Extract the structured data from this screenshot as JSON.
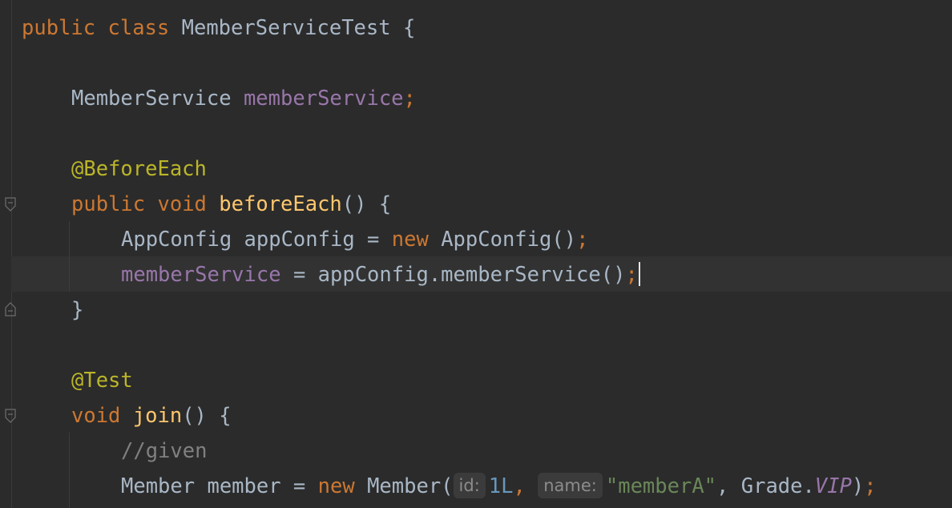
{
  "code": {
    "line1": {
      "kw_public": "public",
      "kw_class": "class",
      "class_name": "MemberServiceTest",
      "brace": "{"
    },
    "line2": {
      "type": "MemberService",
      "field": "memberService",
      "semi": ";"
    },
    "line3": {
      "annotation": "@BeforeEach"
    },
    "line4": {
      "kw_public": "public",
      "kw_void": "void",
      "method": "beforeEach",
      "rest": "() {"
    },
    "line5": {
      "text1": "AppConfig appConfig = ",
      "kw_new": "new",
      "text2": "AppConfig()",
      "semi": ";"
    },
    "line6": {
      "field": "memberService",
      "text": " = appConfig.memberService()",
      "semi": ";"
    },
    "line7": {
      "brace": "}"
    },
    "line8": {
      "annotation": "@Test"
    },
    "line9": {
      "kw_void": "void",
      "method": "join",
      "rest": "() {"
    },
    "line10": {
      "comment": "//given"
    },
    "line11": {
      "text1": "Member member = ",
      "kw_new": "new",
      "text2": "Member(",
      "hint_id": "id:",
      "num": "1L",
      "comma1": ", ",
      "hint_name": "name:",
      "str": "\"memberA\"",
      "text3": ", Grade.",
      "static_field": "VIP",
      "close": ")",
      "semi": ";"
    }
  },
  "colors": {
    "background": "#2b2b2b",
    "keyword": "#cc7832",
    "identifier": "#a9b7c6",
    "field": "#9876aa",
    "annotation": "#bbb529",
    "method": "#ffc66d",
    "comment": "#808080",
    "number": "#6897bb",
    "string": "#6a8759"
  },
  "icons": {
    "fold": "fold-marker-icon",
    "caret": "text-caret"
  }
}
